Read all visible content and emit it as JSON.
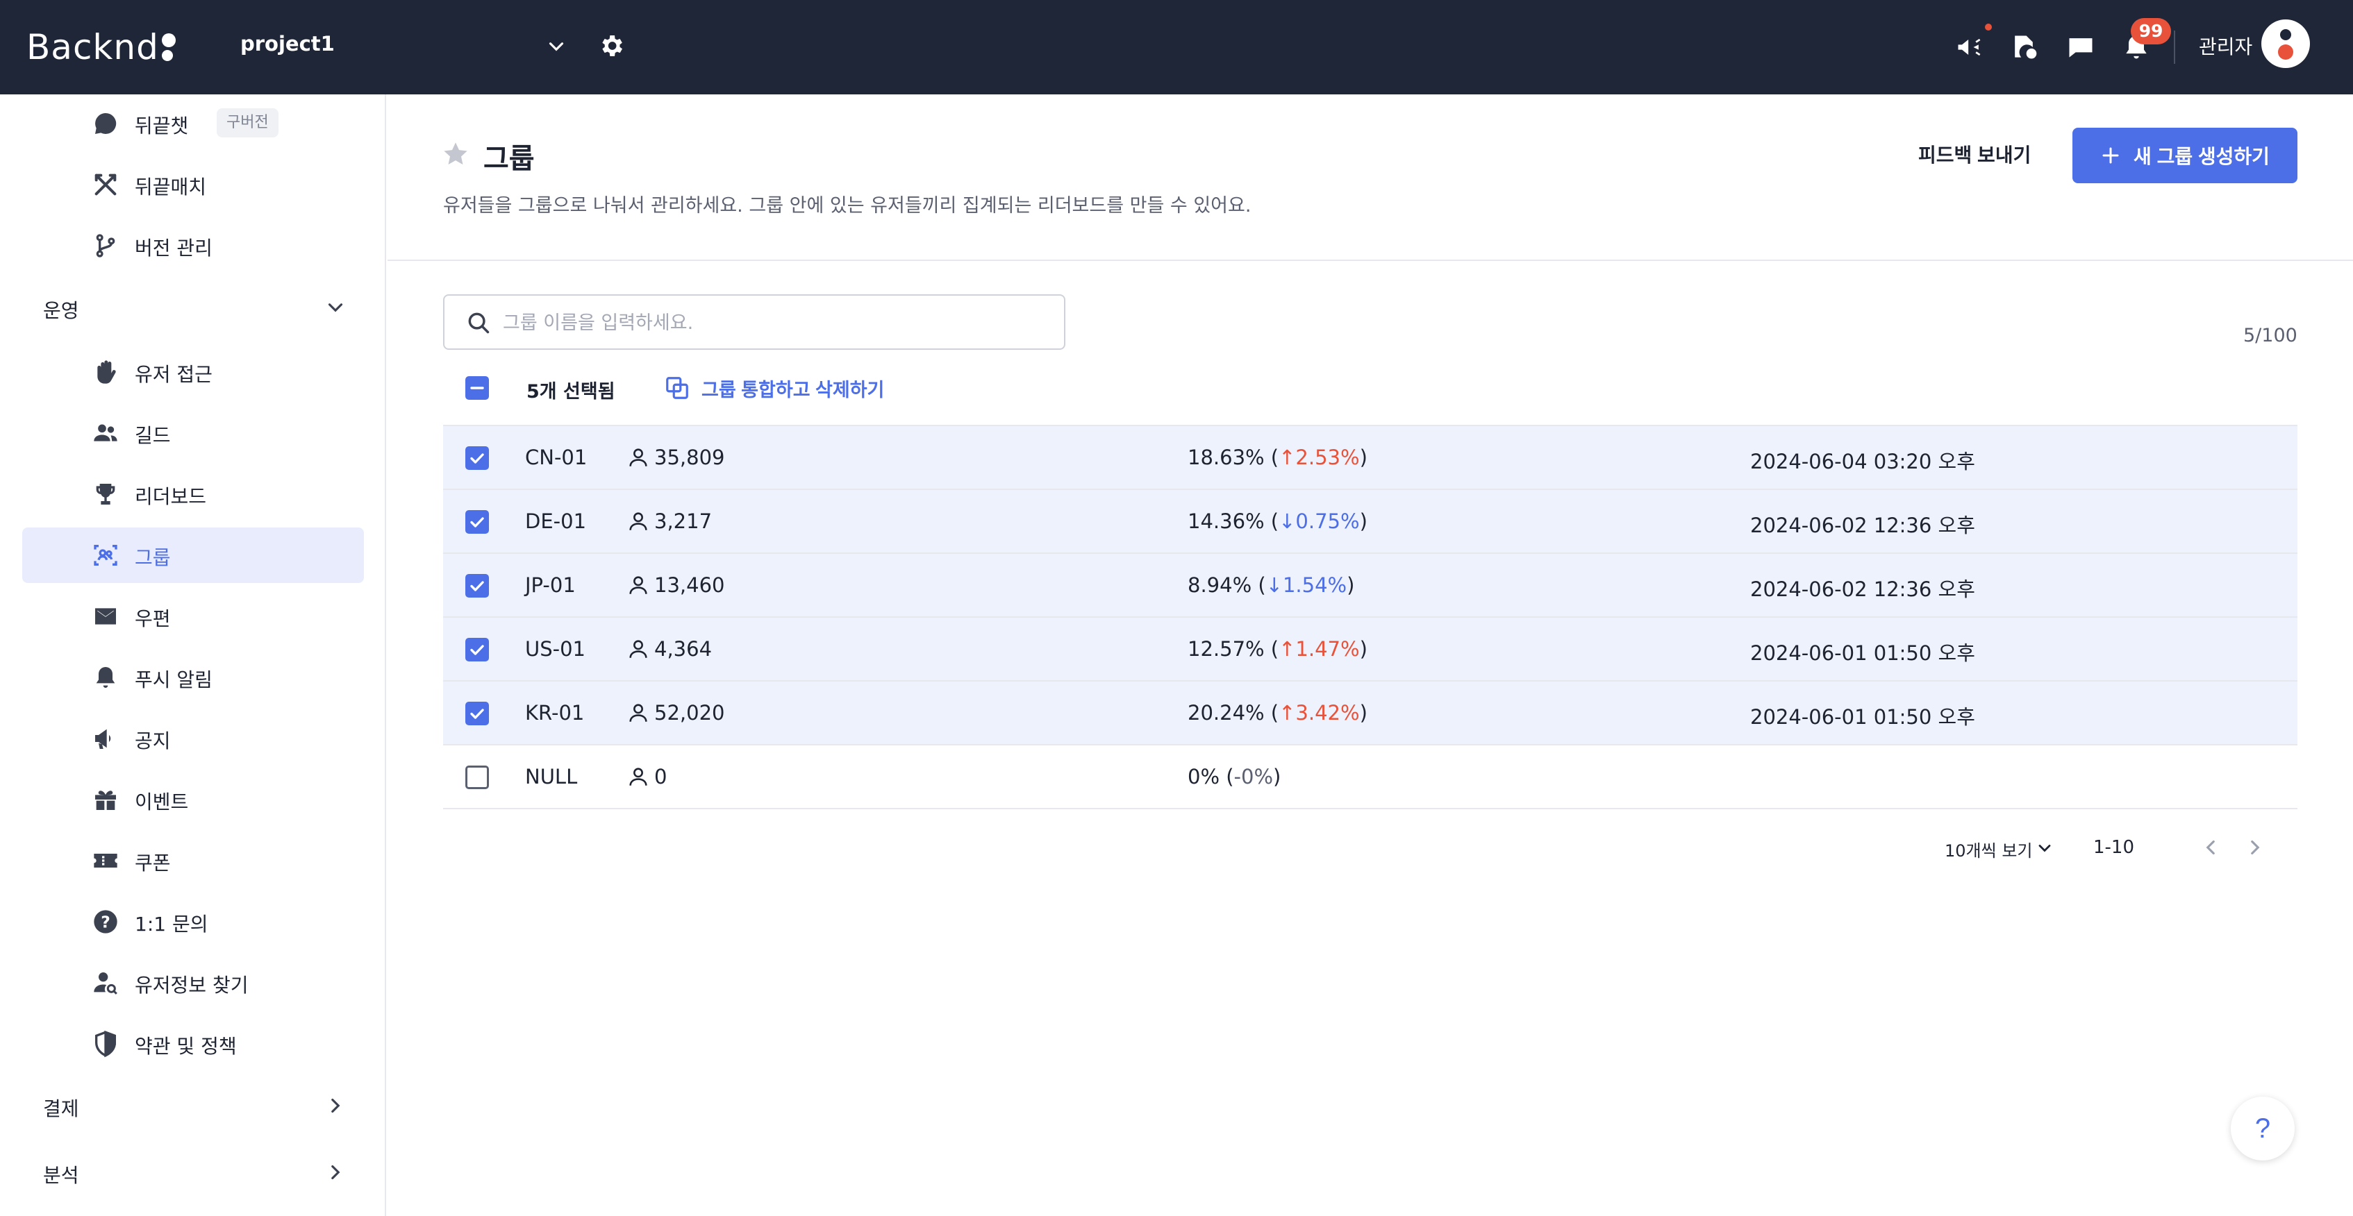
{
  "topbar": {
    "logo": "Backnd",
    "project": "project1",
    "notification_count": "99",
    "admin": "관리자"
  },
  "sidebar": {
    "items_top": [
      {
        "label": "뒤끝챗",
        "tag": "구버전",
        "icon": "chat-icon"
      },
      {
        "label": "뒤끝매치",
        "icon": "swords-icon"
      },
      {
        "label": "버전 관리",
        "icon": "branch-icon"
      }
    ],
    "sections": {
      "operation": "운영",
      "payment": "결제",
      "analytics": "분석"
    },
    "items": [
      {
        "label": "유저 접근",
        "icon": "hand-icon"
      },
      {
        "label": "길드",
        "icon": "people-icon"
      },
      {
        "label": "리더보드",
        "icon": "trophy-icon"
      },
      {
        "label": "그룹",
        "icon": "group-icon"
      },
      {
        "label": "우편",
        "icon": "mail-icon"
      },
      {
        "label": "푸시 알림",
        "icon": "bell-icon"
      },
      {
        "label": "공지",
        "icon": "megaphone-icon"
      },
      {
        "label": "이벤트",
        "icon": "gift-icon"
      },
      {
        "label": "쿠폰",
        "icon": "ticket-icon"
      },
      {
        "label": "1:1 문의",
        "icon": "question-icon"
      },
      {
        "label": "유저정보 찾기",
        "icon": "user-search-icon"
      },
      {
        "label": "약관 및 정책",
        "icon": "shield-icon"
      }
    ]
  },
  "page": {
    "title": "그룹",
    "subtitle": "유저들을 그룹으로 나눠서 관리하세요. 그룹 안에 있는 유저들끼리 집계되는 리더보드를 만들 수 있어요.",
    "feedback_label": "피드백 보내기",
    "new_group_label": "새 그룹 생성하기"
  },
  "search": {
    "placeholder": "그룹 이름을 입력하세요.",
    "value": ""
  },
  "count_label": "5/100",
  "selection": {
    "selected_label": "5개 선택됨",
    "merge_label": "그룹 통합하고 삭제하기"
  },
  "groups": [
    {
      "name": "CN-01",
      "users": "35,809",
      "rate": "18.63% (",
      "change": "2.53%",
      "dir": "up",
      "close": ")",
      "date": "2024-06-04 03:20 오후",
      "checked": true
    },
    {
      "name": "DE-01",
      "users": "3,217",
      "rate": "14.36% (",
      "change": "0.75%",
      "dir": "down",
      "close": ")",
      "date": "2024-06-02 12:36 오후",
      "checked": true
    },
    {
      "name": "JP-01",
      "users": "13,460",
      "rate": "8.94% (",
      "change": "1.54%",
      "dir": "down",
      "close": ")",
      "date": "2024-06-02 12:36 오후",
      "checked": true
    },
    {
      "name": "US-01",
      "users": "4,364",
      "rate": "12.57% (",
      "change": "1.47%",
      "dir": "up",
      "close": ")",
      "date": "2024-06-01 01:50 오후",
      "checked": true
    },
    {
      "name": "KR-01",
      "users": "52,020",
      "rate": "20.24% (",
      "change": "3.42%",
      "dir": "up",
      "close": ")",
      "date": "2024-06-01 01:50 오후",
      "checked": true
    },
    {
      "name": "NULL",
      "users": "0",
      "rate": "0% (",
      "change": "-0%",
      "dir": "none",
      "close": ")",
      "date": "",
      "checked": false
    }
  ],
  "pager": {
    "size_label": "10개씩 보기",
    "range": "1-10"
  },
  "help_label": "?",
  "colors": {
    "topbar": "#1f2637",
    "accent": "#4c6ee6",
    "up": "#e8523a",
    "selected_row": "#eef2fc"
  }
}
